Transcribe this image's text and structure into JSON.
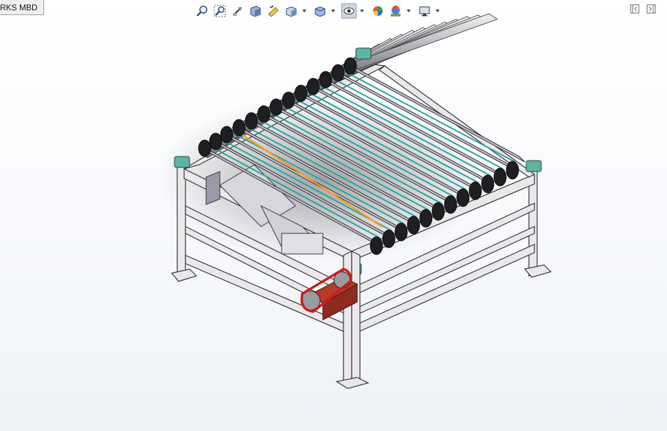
{
  "tab": {
    "label": "RKS MBD"
  },
  "toolbar": {
    "items": [
      "zoom-to-fit-icon",
      "zoom-to-area-icon",
      "previous-view-icon",
      "section-view-icon",
      "dynamic-annotation-views-icon",
      "view-orientation-icon",
      "display-style-icon",
      "hide-show-items-icon",
      "edit-appearance-icon",
      "apply-scene-icon",
      "view-settings-icon"
    ]
  },
  "colors": {
    "frame": "#e9e6ea",
    "frame_edge": "#333333",
    "roller": "#c9c9cc",
    "belt": "#1fa6a6",
    "sprocket": "#222222",
    "bearing": "#5fb3a3",
    "chain": "#cc1b1b",
    "motor": "#b73a2b",
    "highlight": "#ff9a1a"
  }
}
